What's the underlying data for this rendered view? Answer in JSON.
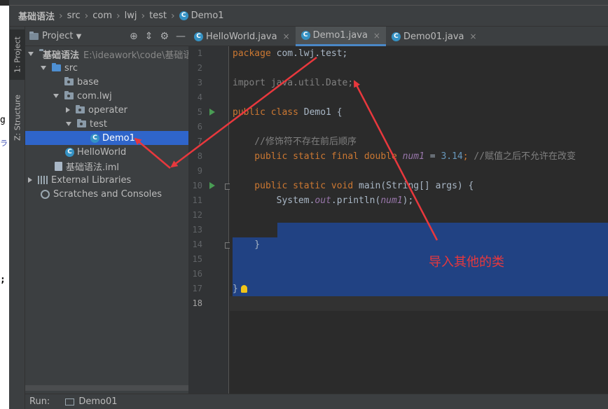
{
  "breadcrumb": {
    "items": [
      "基础语法",
      "src",
      "com",
      "lwj",
      "test",
      "Demo1"
    ]
  },
  "tool_stripe": {
    "project_label": "1: Project",
    "structure_label": "Z: Structure"
  },
  "project_panel": {
    "title": "Project",
    "root_name": "基础语法",
    "root_path": "E:\\ideawork\\code\\基础语",
    "tree": {
      "src": "src",
      "base": "base",
      "com_lwj": "com.lwj",
      "operater": "operater",
      "test": "test",
      "demo1": "Demo1",
      "helloworld": "HelloWorld",
      "iml": "基础语法.iml",
      "external_libraries": "External Libraries",
      "scratches": "Scratches and Consoles"
    }
  },
  "editor": {
    "tabs": [
      {
        "label": "HelloWorld.java",
        "active": false
      },
      {
        "label": "Demo1.java",
        "active": true
      },
      {
        "label": "Demo01.java",
        "active": false
      }
    ],
    "line_numbers": [
      "1",
      "2",
      "3",
      "4",
      "5",
      "6",
      "7",
      "8",
      "9",
      "10",
      "11",
      "12",
      "13",
      "14",
      "15",
      "16",
      "17",
      "18"
    ],
    "code": {
      "l1_kw": "package",
      "l1_rest": " com.lwj.test;",
      "l3": "import java.util.Date;",
      "l5_kw": "public class",
      "l5_rest": " Demo1 {",
      "l7": "    //修饰符不存在前后顺序",
      "l8_kw": "    public static final double",
      "l8_var": "num1",
      "l8_eq": " = ",
      "l8_num": "3.14",
      "l8_semi": ";",
      "l8_cmt": " //赋值之后不允许在改变",
      "l10_kw": "    public static void",
      "l10_rest": " main(String[] args) {",
      "l11_a": "        System.",
      "l11_out": "out",
      "l11_b": ".println(",
      "l11_var": "num1",
      "l11_c": ");",
      "l14": "    }",
      "l17": "}"
    }
  },
  "annotation": {
    "text": "导入其他的类",
    "color": "#e8383d"
  },
  "bottom_bar": {
    "run_label": "Run:",
    "config": "Demo01"
  },
  "sliver_text": {
    "a": "g",
    "b": "ラ",
    "c": ";"
  }
}
